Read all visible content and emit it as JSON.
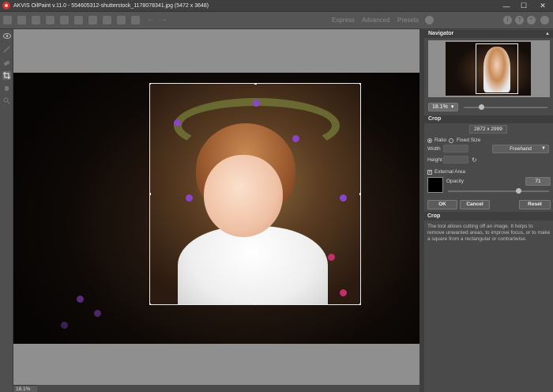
{
  "window": {
    "title": "AKVIS OilPaint v.11.0 - 554605312-shutterstock_1178078341.jpg (5472 x 3648)",
    "controls": [
      "—",
      "☐",
      "✕"
    ]
  },
  "toolbar": {
    "modes": [
      "Express",
      "Advanced",
      "Presets"
    ],
    "right_icons": [
      "info-icon",
      "help-icon",
      "settings-icon",
      "notifications-icon"
    ]
  },
  "tools": [
    "eye-icon",
    "brush-icon",
    "eraser-icon",
    "crop-icon",
    "hand-icon",
    "zoom-icon"
  ],
  "canvas": {
    "zoom_label": "18.1%"
  },
  "navigator": {
    "title": "Navigator",
    "zoom_value": "18.1%",
    "zoom_slider_fraction": 0.18
  },
  "crop": {
    "title": "Crop",
    "size": "2872 x 2999",
    "ratio_label": "Ratio",
    "fixed_size_label": "Fixed Size",
    "width_label": "Width",
    "height_label": "Height",
    "aspect_value": "Freehand",
    "external_area_label": "External Area",
    "external_area_checked": "✓",
    "opacity_label": "Opacity",
    "opacity_value": "71",
    "ok_label": "OK",
    "cancel_label": "Cancel",
    "reset_label": "Reset"
  },
  "help": {
    "title": "Crop",
    "text": "The tool allows cutting off an image. It helps to remove unwanted areas, to improve focus, or to make a square from a rectangular or contrariwise."
  }
}
